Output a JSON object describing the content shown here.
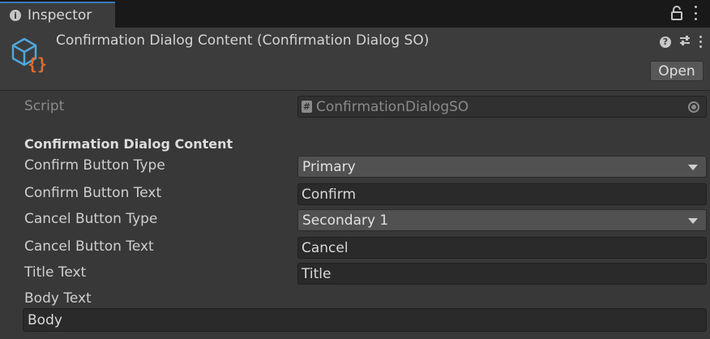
{
  "tab": {
    "title": "Inspector"
  },
  "header": {
    "title": "Confirmation Dialog Content (Confirmation Dialog SO)",
    "open_label": "Open"
  },
  "script_row": {
    "label": "Script",
    "value": "ConfirmationDialogSO"
  },
  "section": {
    "label": "Confirmation Dialog Content"
  },
  "fields": {
    "confirm_button_type": {
      "label": "Confirm Button Type",
      "value": "Primary"
    },
    "confirm_button_text": {
      "label": "Confirm Button Text",
      "value": "Confirm"
    },
    "cancel_button_type": {
      "label": "Cancel Button Type",
      "value": "Secondary 1"
    },
    "cancel_button_text": {
      "label": "Cancel Button Text",
      "value": "Cancel"
    },
    "title_text": {
      "label": "Title Text",
      "value": "Title"
    },
    "body_text": {
      "label": "Body Text",
      "value": "Body"
    }
  },
  "colors": {
    "background": "#383838",
    "tab_accent": "#3a79bb",
    "asset_icon_blue": "#4fa6d8",
    "asset_icon_orange": "#e06c30"
  }
}
